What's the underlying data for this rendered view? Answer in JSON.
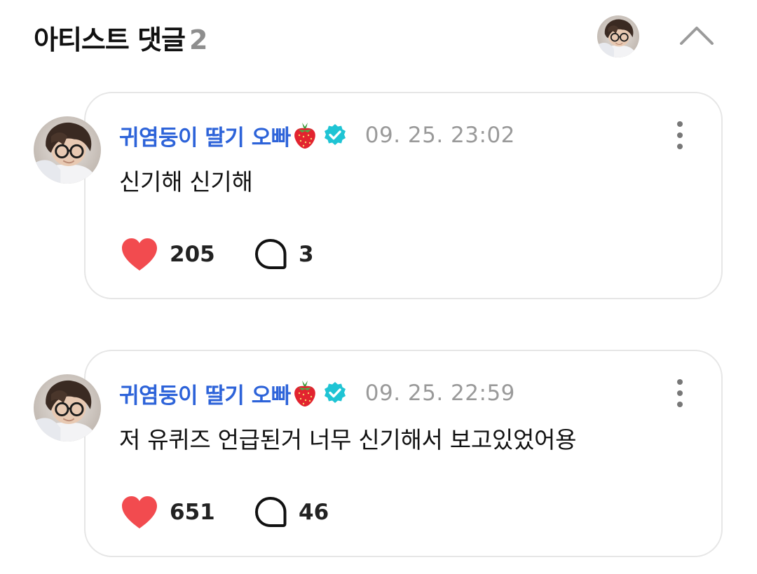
{
  "header": {
    "title": "아티스트 댓글",
    "count": "2"
  },
  "icons": {
    "like": "heart-icon",
    "reply": "speech-bubble-icon",
    "more": "vertical-dots-icon",
    "collapse": "chevron-up-icon",
    "verified": "verified-badge-icon",
    "emoji": "strawberry-emoji"
  },
  "colors": {
    "author": "#2d63d9",
    "verified": "#1fc4d4",
    "heart": "#f24b4f",
    "timestamp": "#9a9a9a"
  },
  "comments": [
    {
      "author": "귀염둥이 딸기 오빠",
      "timestamp": "09. 25. 23:02",
      "text": "신기해 신기해",
      "likes": "205",
      "replies": "3"
    },
    {
      "author": "귀염둥이 딸기 오빠",
      "timestamp": "09. 25. 22:59",
      "text": "저 유퀴즈 언급된거 너무 신기해서 보고있었어용",
      "likes": "651",
      "replies": "46"
    }
  ]
}
